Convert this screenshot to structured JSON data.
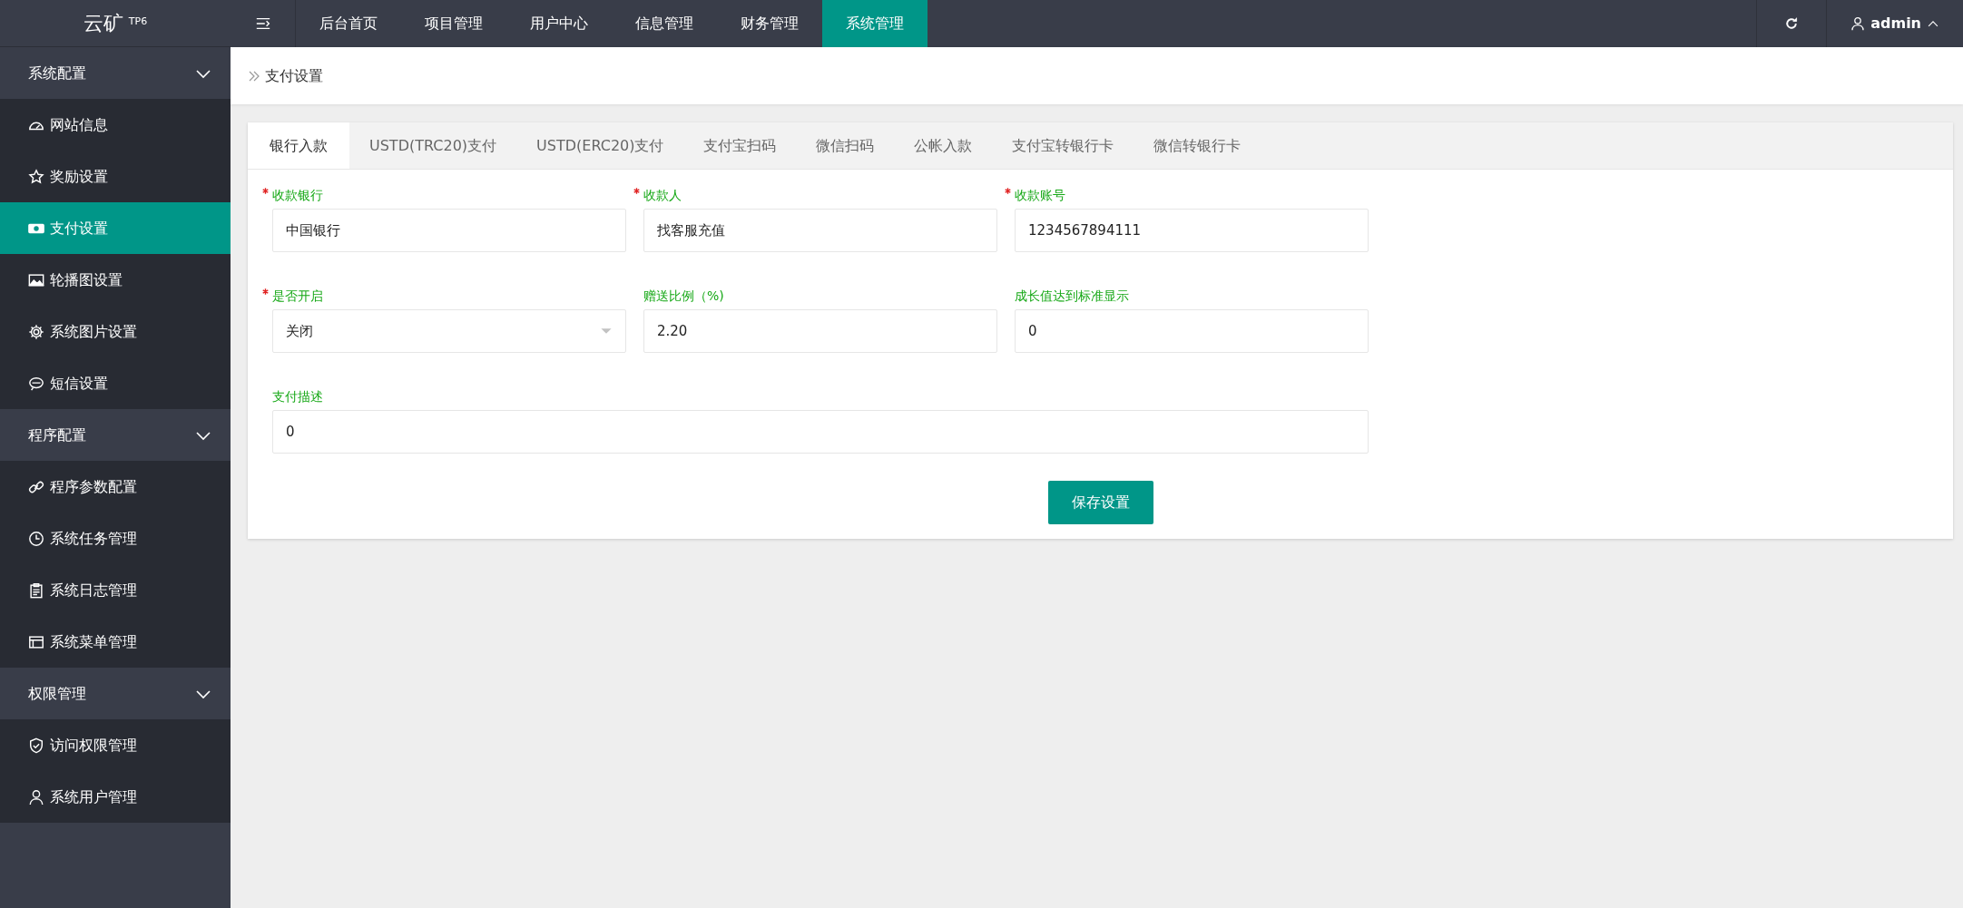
{
  "logo": {
    "text": "云矿",
    "superscript": "TP6"
  },
  "top_nav": [
    {
      "label": "后台首页",
      "selected": false
    },
    {
      "label": "项目管理",
      "selected": false
    },
    {
      "label": "用户中心",
      "selected": false
    },
    {
      "label": "信息管理",
      "selected": false
    },
    {
      "label": "财务管理",
      "selected": false
    },
    {
      "label": "系统管理",
      "selected": true
    }
  ],
  "user": {
    "name": "admin"
  },
  "sidebar": {
    "groups": [
      {
        "label": "系统配置",
        "expanded": true,
        "items": [
          {
            "label": "网站信息",
            "selected": false
          },
          {
            "label": "奖励设置",
            "selected": false
          },
          {
            "label": "支付设置",
            "selected": true
          },
          {
            "label": "轮播图设置",
            "selected": false
          },
          {
            "label": "系统图片设置",
            "selected": false
          },
          {
            "label": "短信设置",
            "selected": false
          }
        ]
      },
      {
        "label": "程序配置",
        "expanded": true,
        "items": [
          {
            "label": "程序参数配置",
            "selected": false
          },
          {
            "label": "系统任务管理",
            "selected": false
          },
          {
            "label": "系统日志管理",
            "selected": false
          },
          {
            "label": "系统菜单管理",
            "selected": false
          }
        ]
      },
      {
        "label": "权限管理",
        "expanded": true,
        "items": [
          {
            "label": "访问权限管理",
            "selected": false
          },
          {
            "label": "系统用户管理",
            "selected": false
          }
        ]
      }
    ]
  },
  "breadcrumb": "支付设置",
  "tabs": [
    {
      "label": "银行入款",
      "selected": true
    },
    {
      "label": "USTD(TRC20)支付",
      "selected": false
    },
    {
      "label": "USTD(ERC20)支付",
      "selected": false
    },
    {
      "label": "支付宝扫码",
      "selected": false
    },
    {
      "label": "微信扫码",
      "selected": false
    },
    {
      "label": "公帐入款",
      "selected": false
    },
    {
      "label": "支付宝转银行卡",
      "selected": false
    },
    {
      "label": "微信转银行卡",
      "selected": false
    }
  ],
  "fields": [
    {
      "kind": "input",
      "label": "收款银行",
      "required": true,
      "value": "中国银行"
    },
    {
      "kind": "input",
      "label": "收款人",
      "required": true,
      "value": "找客服充值"
    },
    {
      "kind": "input",
      "label": "收款账号",
      "required": true,
      "value": "1234567894111"
    },
    {
      "kind": "select",
      "label": "是否开启",
      "required": true,
      "value": "关闭"
    },
    {
      "kind": "input",
      "label": "赠送比例（%)",
      "required": false,
      "value": "2.20"
    },
    {
      "kind": "input",
      "label": "成长值达到标准显示",
      "required": false,
      "value": "0"
    },
    {
      "kind": "wide",
      "label": "支付描述",
      "required": false,
      "value": "0"
    }
  ],
  "save_button": "保存设置"
}
